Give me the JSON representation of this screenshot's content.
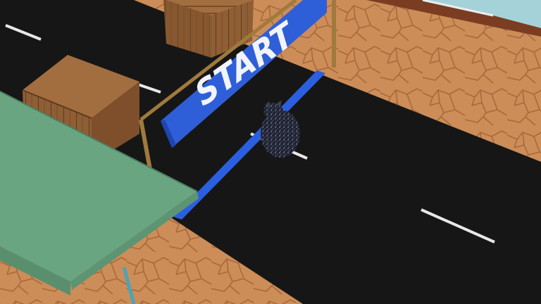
{
  "scene": {
    "banner": {
      "text": "START"
    },
    "colors": {
      "dirt": "#c98a55",
      "road": "#161616",
      "start_line": "#2a5fe0",
      "banner": "#2f5fd8",
      "crate": "#8a5a33",
      "canopy": "#6aa581",
      "pole": "#a07a3c"
    },
    "objects": [
      "dirt-ground",
      "road",
      "start-line",
      "lane-markings",
      "crates",
      "start-banner",
      "player-character",
      "canopy",
      "building"
    ]
  }
}
